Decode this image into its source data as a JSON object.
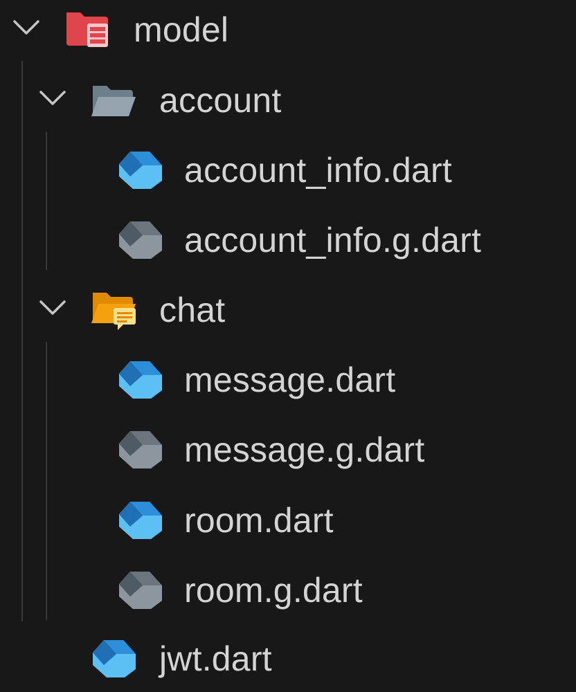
{
  "explorer": {
    "model": {
      "label": "model",
      "icon": "folder-open-database-icon",
      "expanded": true,
      "color": "#e0454b"
    },
    "account": {
      "label": "account",
      "icon": "folder-open-icon",
      "expanded": true,
      "color": "#8a9aa6"
    },
    "account_files": [
      {
        "label": "account_info.dart",
        "icon": "dart-icon",
        "generated": false
      },
      {
        "label": "account_info.g.dart",
        "icon": "dart-generated-icon",
        "generated": true
      }
    ],
    "chat": {
      "label": "chat",
      "icon": "folder-open-chat-icon",
      "expanded": true,
      "color": "#f5a00f"
    },
    "chat_files": [
      {
        "label": "message.dart",
        "icon": "dart-icon",
        "generated": false
      },
      {
        "label": "message.g.dart",
        "icon": "dart-generated-icon",
        "generated": true
      },
      {
        "label": "room.dart",
        "icon": "dart-icon",
        "generated": false
      },
      {
        "label": "room.g.dart",
        "icon": "dart-generated-icon",
        "generated": true
      }
    ],
    "jwt": {
      "label": "jwt.dart",
      "icon": "dart-icon",
      "generated": false
    }
  },
  "colors": {
    "background": "#181818",
    "text": "#d4d4d4",
    "dart_blue_light": "#5cc0f5",
    "dart_blue_dark": "#1f6fb5",
    "dart_gray_light": "#8c969e",
    "dart_gray_dark": "#4f5b64"
  }
}
